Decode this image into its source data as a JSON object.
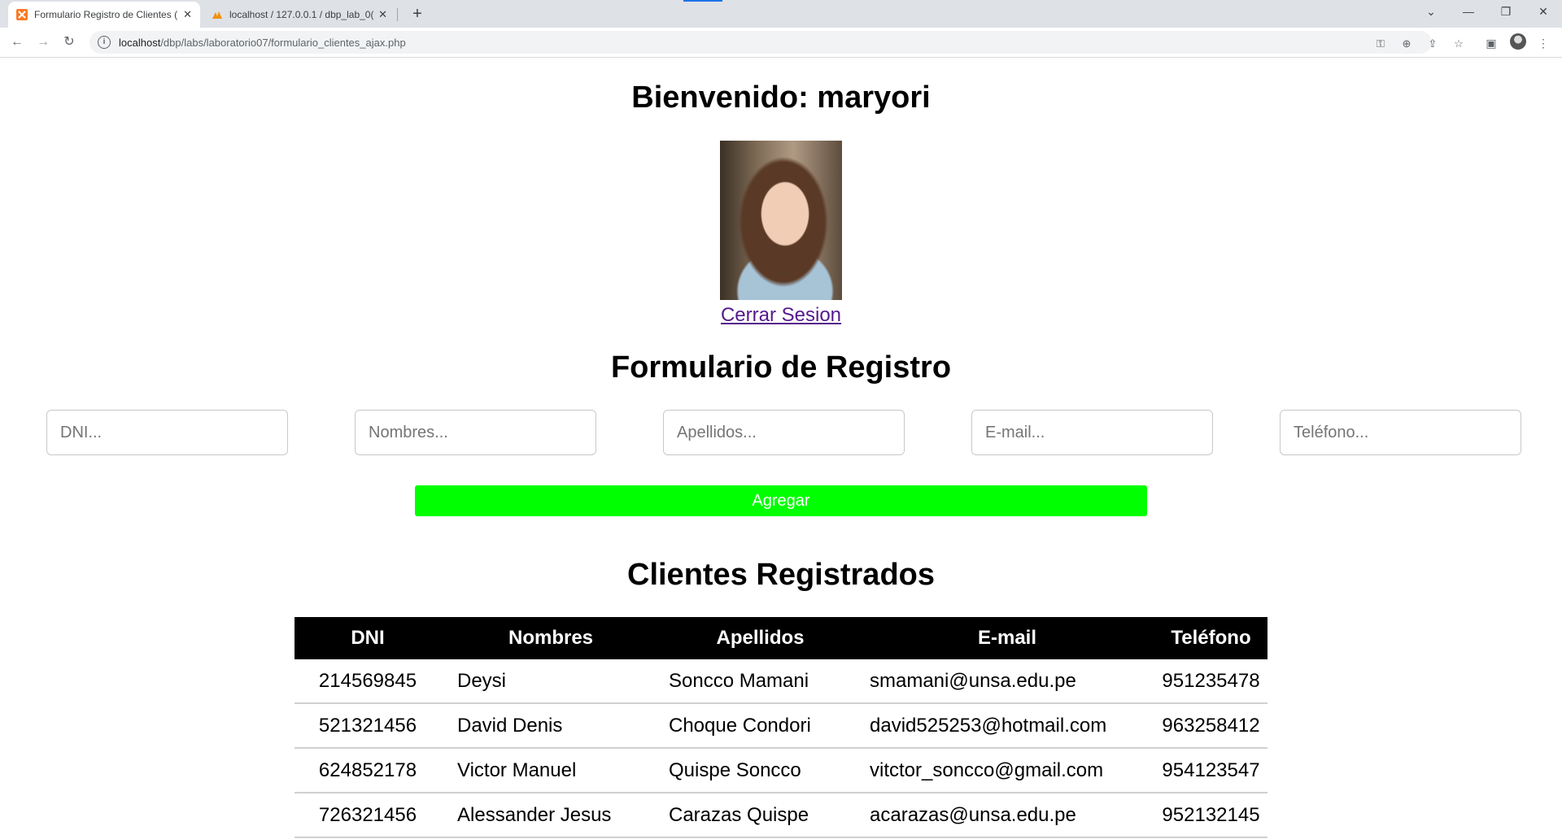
{
  "browser": {
    "tabs": [
      {
        "title": "Formulario Registro de Clientes (",
        "active": true,
        "favicon": "xampp-icon"
      },
      {
        "title": "localhost / 127.0.0.1 / dbp_lab_0(",
        "active": false,
        "favicon": "phpmyadmin-icon"
      }
    ],
    "new_tab": "+",
    "url_host": "localhost",
    "url_path": "/dbp/labs/laboratorio07/formulario_clientes_ajax.php"
  },
  "page": {
    "welcome": "Bienvenido: maryori",
    "logout_link": "Cerrar Sesion",
    "form_title": "Formulario de Registro",
    "fields": {
      "dni_placeholder": "DNI...",
      "nombres_placeholder": "Nombres...",
      "apellidos_placeholder": "Apellidos...",
      "email_placeholder": "E-mail...",
      "telefono_placeholder": "Teléfono..."
    },
    "add_button": "Agregar",
    "list_title": "Clientes Registrados",
    "table": {
      "headers": [
        "DNI",
        "Nombres",
        "Apellidos",
        "E-mail",
        "Teléfono"
      ],
      "rows": [
        [
          "214569845",
          "Deysi",
          "Soncco Mamani",
          "smamani@unsa.edu.pe",
          "951235478"
        ],
        [
          "521321456",
          "David Denis",
          "Choque Condori",
          "david525253@hotmail.com",
          "963258412"
        ],
        [
          "624852178",
          "Victor Manuel",
          "Quispe Soncco",
          "vitctor_soncco@gmail.com",
          "954123547"
        ],
        [
          "726321456",
          "Alessander Jesus",
          "Carazas Quispe",
          "acarazas@unsa.edu.pe",
          "952132145"
        ]
      ]
    },
    "colors": {
      "add_button": "#00ff00",
      "table_header": "#000000",
      "link": "#551a8b"
    }
  }
}
